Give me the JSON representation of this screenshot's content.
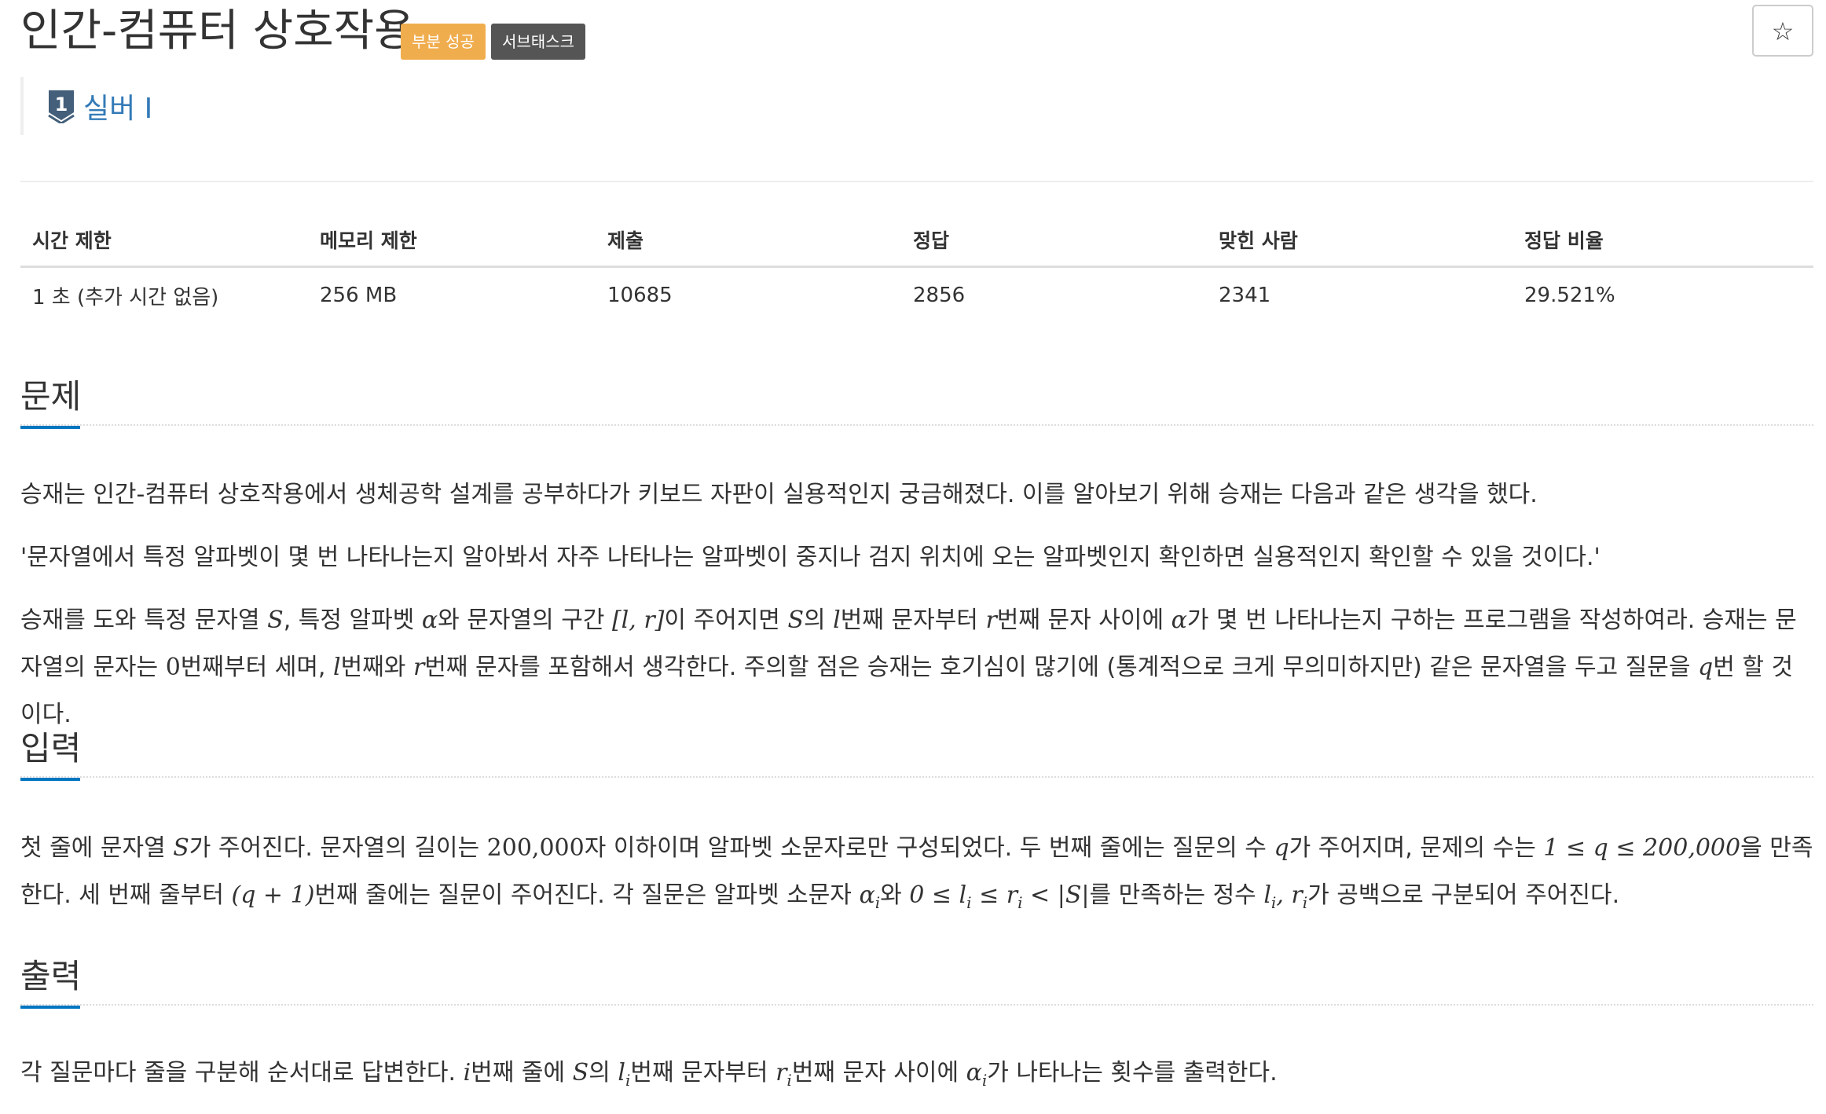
{
  "header": {
    "title": "인간-컴퓨터 상호작용",
    "labels": {
      "partial": "부분 성공",
      "subtask": "서브태스크"
    },
    "star_icon": "☆",
    "tier": {
      "text": "실버 I",
      "badge_number": "1"
    }
  },
  "info_table": {
    "headers": [
      "시간 제한",
      "메모리 제한",
      "제출",
      "정답",
      "맞힌 사람",
      "정답 비율"
    ],
    "values": [
      "1 초 (추가 시간 없음)",
      "256 MB",
      "10685",
      "2856",
      "2341",
      "29.521%"
    ]
  },
  "sections": {
    "problem": {
      "title": "문제",
      "p1": "승재는 인간-컴퓨터 상호작용에서 생체공학 설계를 공부하다가 키보드 자판이 실용적인지 궁금해졌다. 이를 알아보기 위해 승재는 다음과 같은 생각을 했다.",
      "p2": "'문자열에서 특정 알파벳이 몇 번 나타나는지 알아봐서 자주 나타나는 알파벳이 중지나 검지 위치에 오는 알파벳인지 확인하면 실용적인지 확인할 수 있을 것이다.'",
      "p3": {
        "t1": "승재를 도와 특정 문자열 ",
        "s": "S",
        "t2": ", 특정 알파벳 ",
        "alpha": "α",
        "t3": "와 문자열의 구간 ",
        "interval": "[l, r]",
        "t4": "이 주어지면 ",
        "s2": "S",
        "t5": "의 ",
        "l": "l",
        "t6": "번째 문자부터 ",
        "r": "r",
        "t7": "번째 문자 사이에 ",
        "alpha2": "α",
        "t8": "가 몇 번 나타나는지 구하는 프로그램을 작성하여라. 승재는 문자열의 문자는 ",
        "zero": "0",
        "t9": "번째부터 세며, ",
        "l2": "l",
        "t10": "번째와 ",
        "r2": "r",
        "t11": "번째 문자를 포함해서 생각한다. 주의할 점은 승재는 호기심이 많기에 (통계적으로 크게 무의미하지만) 같은 문자열을 두고 질문을 ",
        "q": "q",
        "t12": "번 할 것이다."
      }
    },
    "input": {
      "title": "입력",
      "t1": "첫 줄에 문자열 ",
      "s": "S",
      "t2": "가 주어진다. 문자열의 길이는 ",
      "len": "200,000",
      "t3": "자 이하이며 알파벳 소문자로만 구성되었다. 두 번째 줄에는 질문의 수 ",
      "q": "q",
      "t4": "가 주어지며, 문제의 수는 ",
      "qrange": "1 ≤ q ≤ 200,000",
      "t5": "을 만족한다. 세 번째 줄부터 ",
      "qplus": "(q + 1)",
      "t6": "번째 줄에는 질문이 주어진다. 각 질문은 알파벳 소문자 ",
      "alpha_i": "α",
      "sub_i": "i",
      "t7": "와 ",
      "lrange": "0 ≤ l",
      "sub_i2": "i",
      "lrange2": " ≤ r",
      "sub_i3": "i",
      "lrange3": " < |S|",
      "t8": "를 만족하는 정수 ",
      "lr": "l",
      "sub_i4": "i",
      "lr2": ", r",
      "sub_i5": "i",
      "t9": "가 공백으로 구분되어 주어진다."
    },
    "output": {
      "title": "출력",
      "t1": "각 질문마다 줄을 구분해 순서대로 답변한다. ",
      "i": "i",
      "t2": "번째 줄에 ",
      "s": "S",
      "t3": "의 ",
      "l": "l",
      "sub_i": "i",
      "t4": "번째 문자부터 ",
      "r": "r",
      "sub_i2": "i",
      "t5": "번째 문자 사이에 ",
      "alpha": "α",
      "sub_i3": "i",
      "t6": "가 나타나는 횟수를 출력한다."
    }
  }
}
